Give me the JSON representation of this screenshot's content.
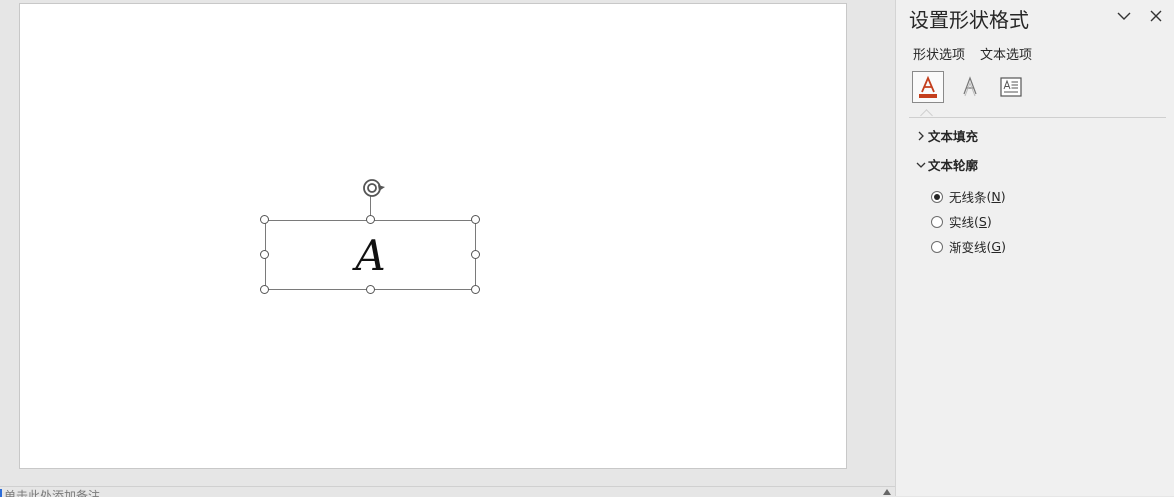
{
  "notes": {
    "placeholder": "单击此处添加备注"
  },
  "slide": {
    "textbox_text": "A"
  },
  "pane": {
    "title": "设置形状格式",
    "tabs": [
      {
        "label": "形状选项",
        "active": false
      },
      {
        "label": "文本选项",
        "active": true
      }
    ],
    "icon_buttons": [
      {
        "name": "text-fill-outline-icon",
        "active": true
      },
      {
        "name": "text-effects-icon",
        "active": false
      },
      {
        "name": "textbox-layout-icon",
        "active": false
      }
    ],
    "sections": [
      {
        "label": "文本填充",
        "expanded": false
      },
      {
        "label": "文本轮廓",
        "expanded": true
      }
    ],
    "outline_options": [
      {
        "label": "无线条",
        "mnemonic": "N",
        "selected": true
      },
      {
        "label": "实线",
        "mnemonic": "S",
        "selected": false
      },
      {
        "label": "渐变线",
        "mnemonic": "G",
        "selected": false
      }
    ]
  },
  "colors": {
    "accent_red": "#c43e1c",
    "pane_bg": "#f0f0f0",
    "workspace_bg": "#e6e6e6"
  }
}
